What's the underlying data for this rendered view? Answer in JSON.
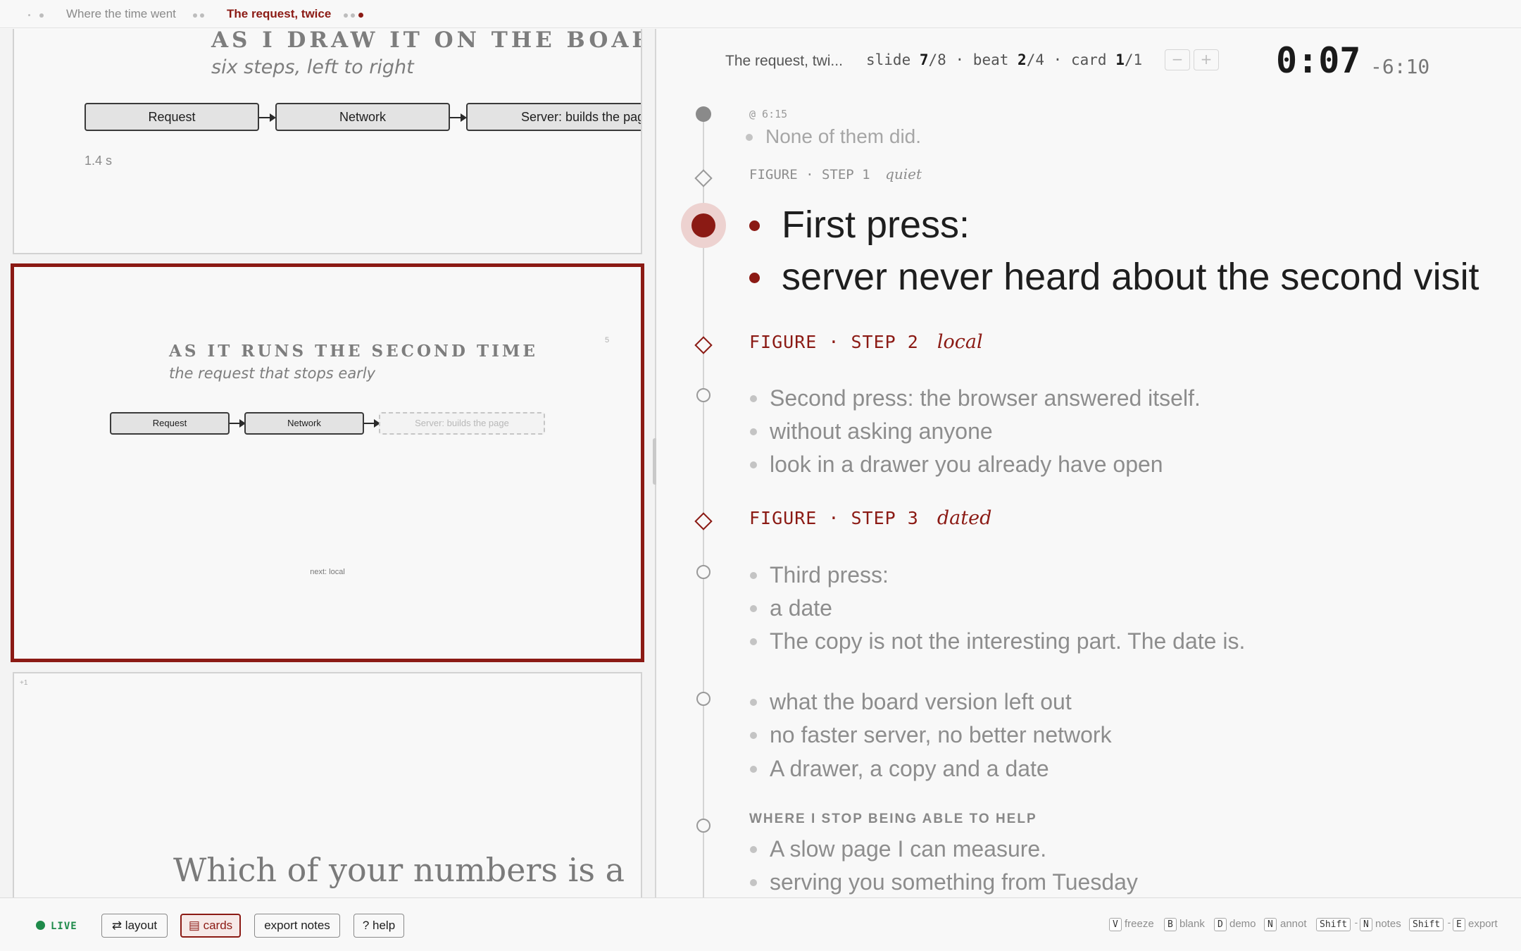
{
  "topbar": {
    "crumbs": [
      "Where the time went",
      "The request, twice"
    ]
  },
  "slides": {
    "previous": {
      "title": "AS I DRAW IT ON THE BOARD",
      "subtitle": "six steps, left to right",
      "steps": [
        "Request",
        "Network",
        "Server: builds the page"
      ],
      "timing": "1.4 s"
    },
    "current": {
      "title": "AS IT RUNS THE SECOND TIME",
      "subtitle": "the request that stops early",
      "slide_number": "5",
      "steps": [
        "Request",
        "Network",
        "Server: builds the page"
      ],
      "next_label": "next: local"
    },
    "next": {
      "offset_label": "+1",
      "headline": "Which of your numbers is a"
    }
  },
  "notes": {
    "deck_title": "The request, twi...",
    "slide_label": "slide",
    "slide_current": "7",
    "slide_total": "/8",
    "beat_label": "beat",
    "beat_current": "2",
    "beat_total": "/4",
    "card_label": "card",
    "card_current": "1",
    "card_total": "/1",
    "separator": "·",
    "minus": "−",
    "plus": "+",
    "clock": "0:07",
    "remaining": "-6:10",
    "timestamp": "@ 6:15",
    "past_line": "None of them did.",
    "figure_label": "FIGURE · STEP",
    "step1_num": "1",
    "step1_cue": "quiet",
    "current_lines": [
      "First press:",
      "server never heard about the second visit"
    ],
    "step2_num": "2",
    "step2_cue": "local",
    "step2_lines": [
      "Second press: the browser answered itself.",
      "without asking anyone",
      "look in a drawer you already have open"
    ],
    "step3_num": "3",
    "step3_cue": "dated",
    "step3_lines": [
      "Third press:",
      "a date",
      "The copy is not the interesting part. The date is."
    ],
    "wrap_lines": [
      "what the board version left out",
      "no faster server, no better network",
      "A drawer, a copy and a date"
    ],
    "section_title": "WHERE I STOP BEING ABLE TO HELP",
    "section_lines": [
      "A slow page I can measure.",
      "serving you something from Tuesday"
    ]
  },
  "toolbar": {
    "live": "LIVE",
    "layout": "⇄ layout",
    "cards": "▤ cards",
    "export_notes": "export notes",
    "help": "? help",
    "shortcuts": [
      {
        "keys": [
          "V"
        ],
        "label": "freeze"
      },
      {
        "keys": [
          "B"
        ],
        "label": "blank"
      },
      {
        "keys": [
          "D"
        ],
        "label": "demo"
      },
      {
        "keys": [
          "N"
        ],
        "label": "annot"
      },
      {
        "keys": [
          "Shift",
          "N"
        ],
        "label": "notes"
      },
      {
        "keys": [
          "Shift",
          "E"
        ],
        "label": "export"
      }
    ],
    "key_joiner": "-"
  },
  "colors": {
    "accent": "#8b1a14",
    "live": "#1e8a4a",
    "muted": "#8d8d8d"
  }
}
